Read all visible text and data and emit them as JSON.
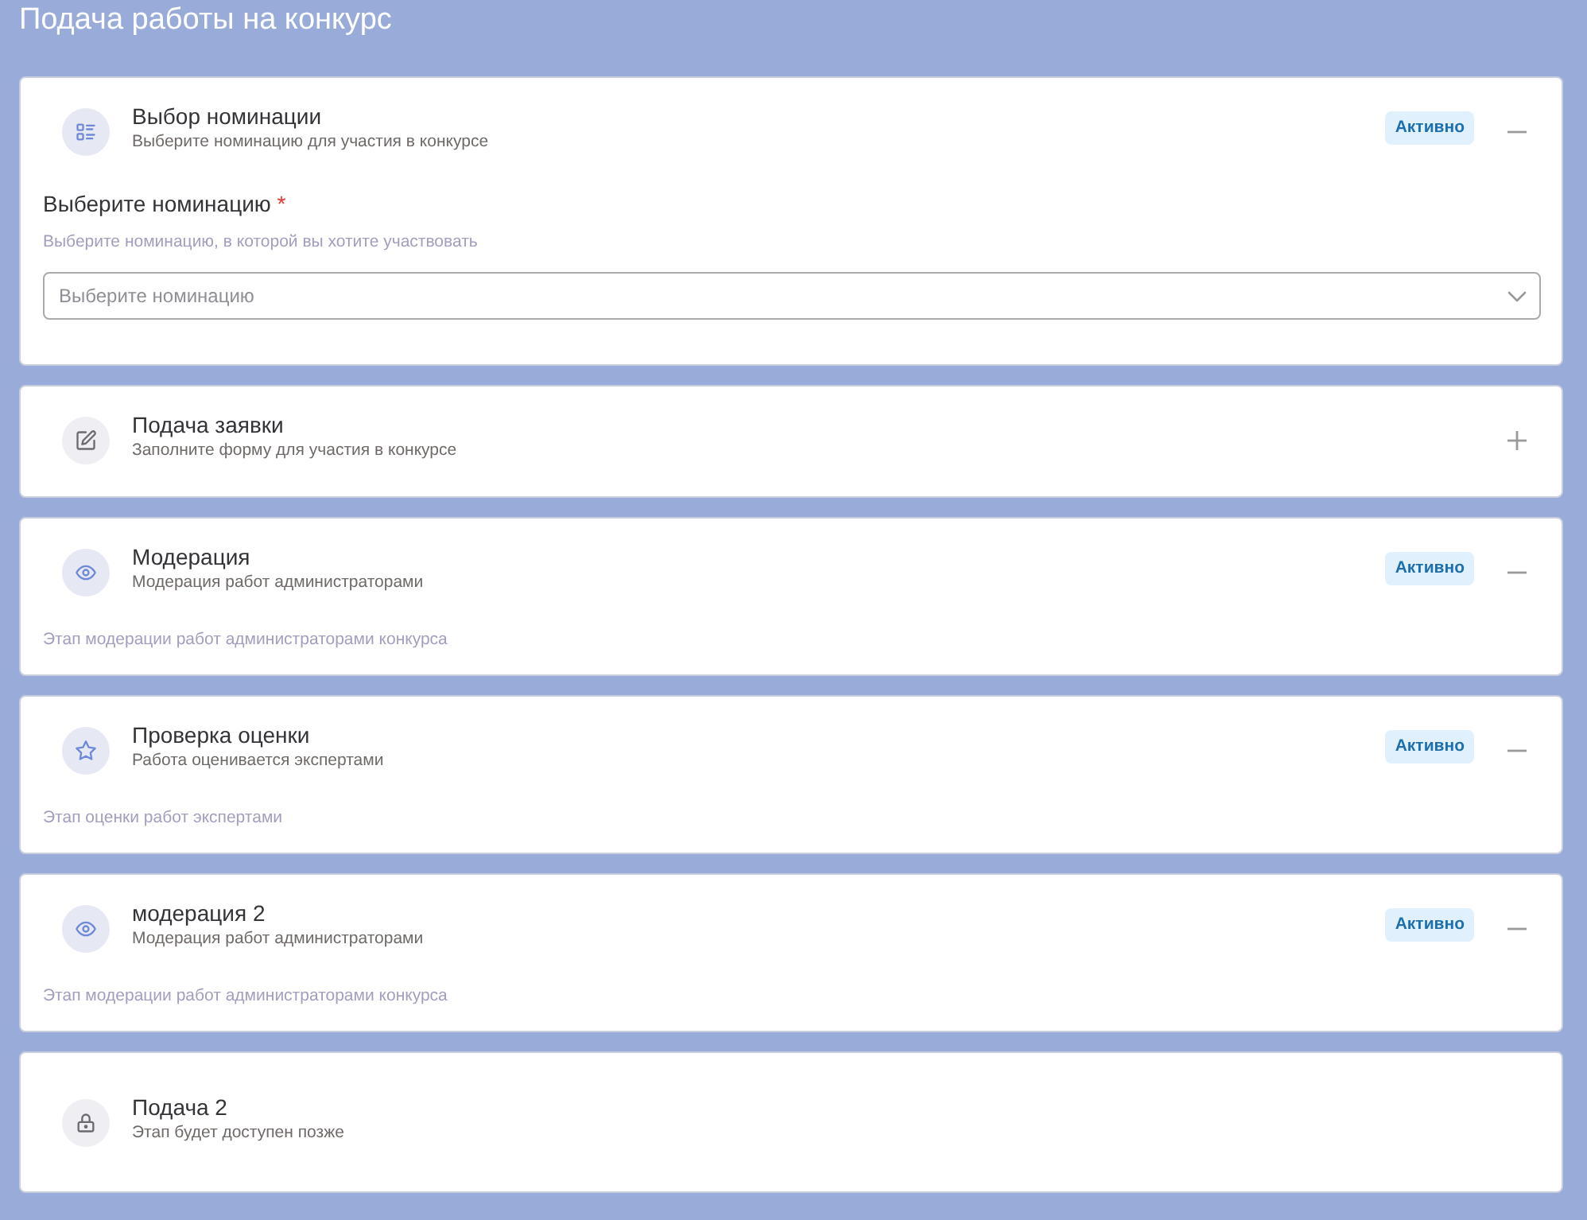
{
  "page": {
    "title": "Подача работы на конкурс"
  },
  "stages": [
    {
      "kind": "nomination",
      "title": "Выбор номинации",
      "subtitle": "Выберите номинацию для участия в конкурсе",
      "active": true,
      "badge": "Активно",
      "expanded": true,
      "body": {
        "kind": "select",
        "label": "Выберите номинацию",
        "required_mark": "*",
        "hint": "Выберите номинацию, в которой вы хотите участвовать",
        "placeholder": "Выберите номинацию"
      }
    },
    {
      "kind": "application",
      "title": "Подача заявки",
      "subtitle": "Заполните форму для участия в конкурсе",
      "active": false,
      "expanded": false
    },
    {
      "kind": "moderation",
      "title": "Модерация",
      "subtitle": "Модерация работ администраторами",
      "active": true,
      "badge": "Активно",
      "expanded": true,
      "body": {
        "kind": "text",
        "description": "Этап модерации работ администраторами конкурса"
      }
    },
    {
      "kind": "rating",
      "title": "Проверка оценки",
      "subtitle": "Работа оценивается экспертами",
      "active": true,
      "badge": "Активно",
      "expanded": true,
      "body": {
        "kind": "text",
        "description": "Этап оценки работ экспертами"
      }
    },
    {
      "kind": "moderation",
      "title": "модерация 2",
      "subtitle": "Модерация работ администраторами",
      "active": true,
      "badge": "Активно",
      "expanded": true,
      "body": {
        "kind": "text",
        "description": "Этап модерации работ администраторами конкурса"
      }
    },
    {
      "kind": "locked",
      "title": "Подача 2",
      "subtitle": "Этап будет доступен позже",
      "active": false
    }
  ]
}
